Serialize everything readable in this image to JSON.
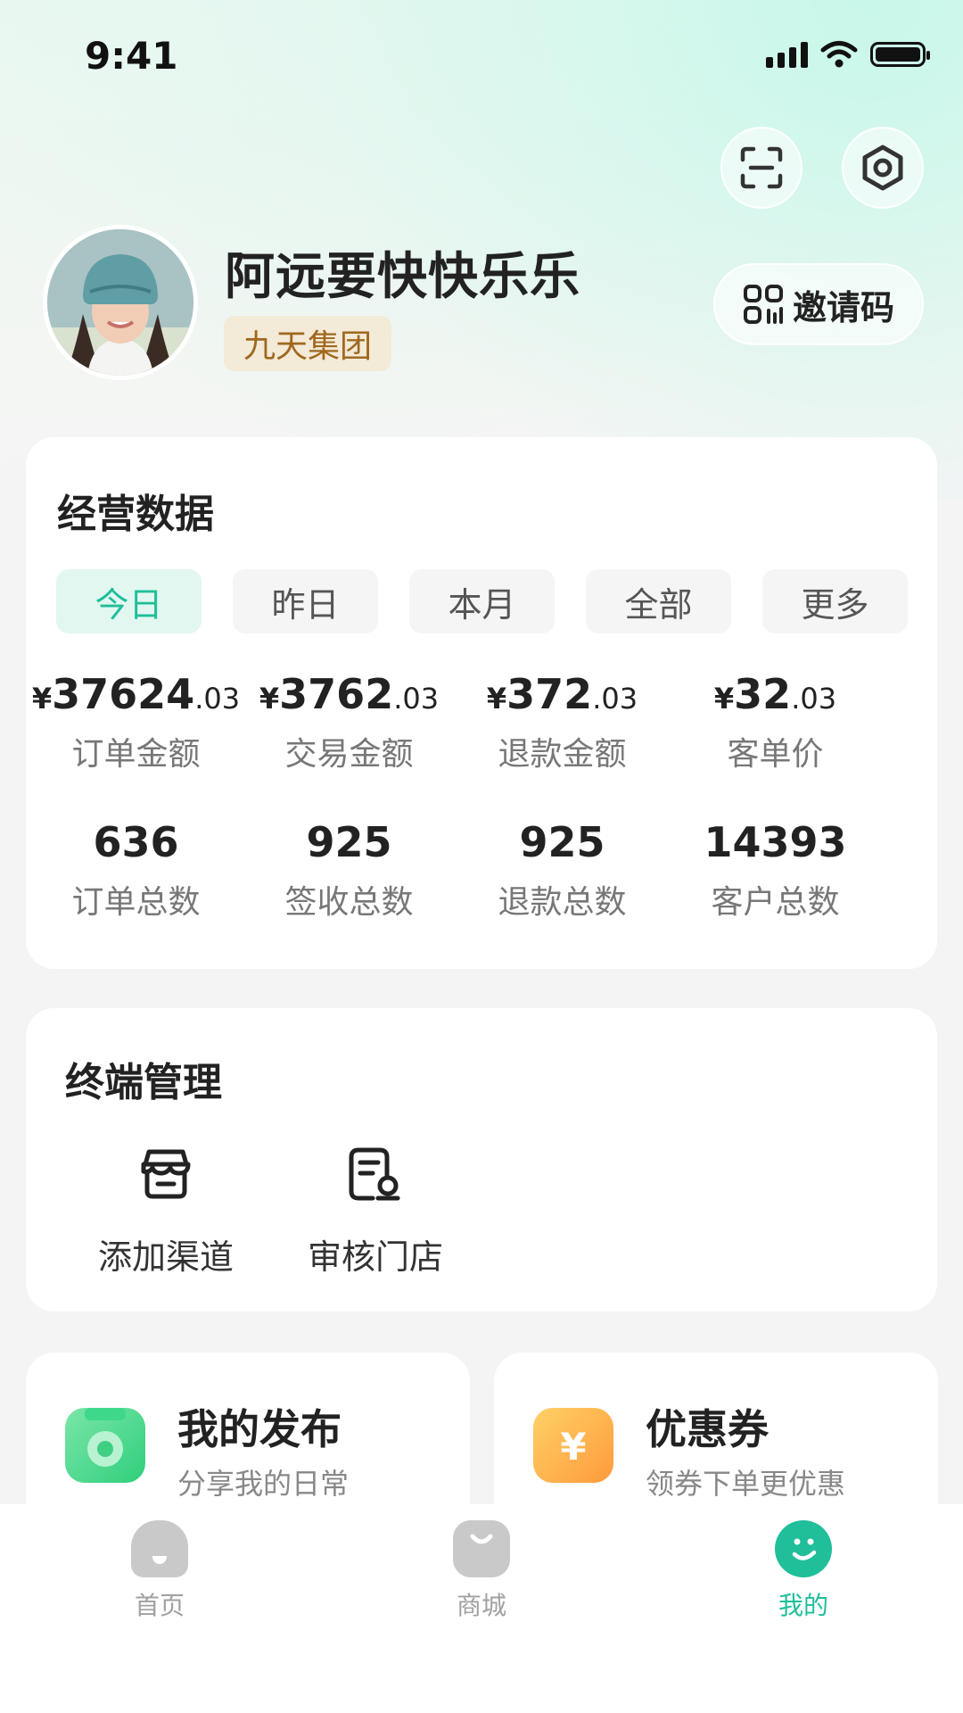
{
  "status_bar": {
    "time": "9:41"
  },
  "header": {
    "scan_icon": "scan-icon",
    "settings_icon": "settings-icon",
    "username": "阿远要快快乐乐",
    "company": "九天集团",
    "invite_label": "邀请码"
  },
  "business_data": {
    "title": "经营数据",
    "tabs": [
      {
        "label": "今日",
        "active": true
      },
      {
        "label": "昨日",
        "active": false
      },
      {
        "label": "本月",
        "active": false
      },
      {
        "label": "全部",
        "active": false
      },
      {
        "label": "更多",
        "active": false
      }
    ],
    "money_stats": [
      {
        "currency": "¥",
        "integer": "37624",
        "decimal": ".03",
        "label": "订单金额"
      },
      {
        "currency": "¥",
        "integer": "3762",
        "decimal": ".03",
        "label": "交易金额"
      },
      {
        "currency": "¥",
        "integer": "372",
        "decimal": ".03",
        "label": "退款金额"
      },
      {
        "currency": "¥",
        "integer": "32",
        "decimal": ".03",
        "label": "客单价"
      }
    ],
    "count_stats": [
      {
        "value": "636",
        "label": "订单总数"
      },
      {
        "value": "925",
        "label": "签收总数"
      },
      {
        "value": "925",
        "label": "退款总数"
      },
      {
        "value": "14393",
        "label": "客户总数"
      }
    ]
  },
  "terminal": {
    "title": "终端管理",
    "items": [
      {
        "label": "添加渠道",
        "icon": "store-icon"
      },
      {
        "label": "审核门店",
        "icon": "audit-store-icon"
      }
    ]
  },
  "promo": [
    {
      "title": "我的发布",
      "subtitle": "分享我的日常",
      "icon": "camera-icon",
      "color": "#3ed48a"
    },
    {
      "title": "优惠券",
      "subtitle": "领券下单更优惠",
      "icon": "coupon-icon",
      "color": "#ffa83a"
    }
  ],
  "bottom_nav": [
    {
      "label": "首页",
      "icon": "home-icon",
      "active": false
    },
    {
      "label": "商城",
      "icon": "shop-bag-icon",
      "active": false
    },
    {
      "label": "我的",
      "icon": "smile-icon",
      "active": true
    }
  ],
  "colors": {
    "accent": "#1fbf9a",
    "badge_text": "#a0681e",
    "badge_bg": "#f3ead7"
  }
}
